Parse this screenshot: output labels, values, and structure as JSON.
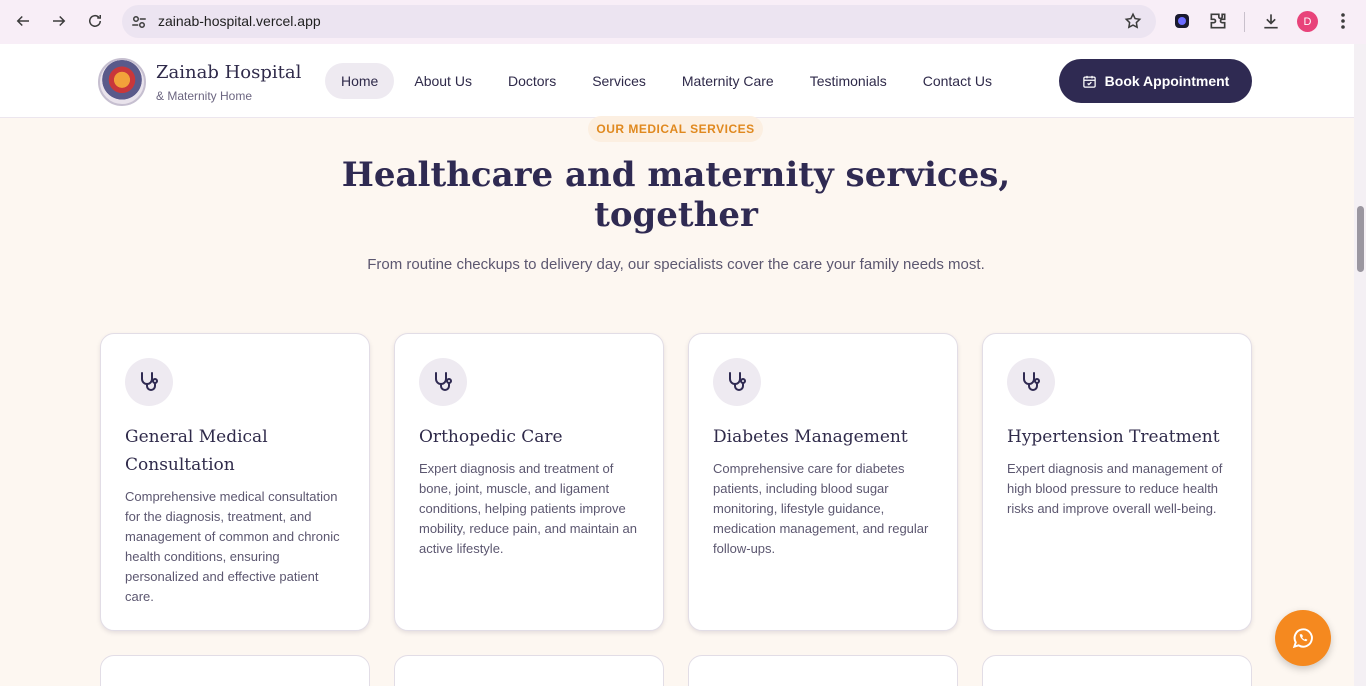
{
  "browser": {
    "url": "zainab-hospital.vercel.app",
    "profile_initial": "D"
  },
  "header": {
    "brand_name": "Zainab Hospital",
    "brand_sub": "& Maternity Home",
    "menu": [
      {
        "label": "Home",
        "active": true
      },
      {
        "label": "About Us"
      },
      {
        "label": "Doctors"
      },
      {
        "label": "Services"
      },
      {
        "label": "Maternity Care"
      },
      {
        "label": "Testimonials"
      },
      {
        "label": "Contact Us"
      }
    ],
    "book_label": "Book Appointment"
  },
  "section": {
    "eyebrow": "OUR MEDICAL SERVICES",
    "headline_line1": "Healthcare and maternity services,",
    "headline_line2": "together",
    "subline": "From routine checkups to delivery day, our specialists cover the care your family needs most."
  },
  "cards": [
    {
      "title": "General Medical Consultation",
      "desc": "Comprehensive medical consultation for the diagnosis, treatment, and management of common and chronic health conditions, ensuring personalized and effective patient care.",
      "icon": "stethoscope-icon"
    },
    {
      "title": "Orthopedic Care",
      "desc": "Expert diagnosis and treatment of bone, joint, muscle, and ligament conditions, helping patients improve mobility, reduce pain, and maintain an active lifestyle.",
      "icon": "stethoscope-icon"
    },
    {
      "title": "Diabetes Management",
      "desc": "Comprehensive care for diabetes patients, including blood sugar monitoring, lifestyle guidance, medication management, and regular follow-ups.",
      "icon": "stethoscope-icon"
    },
    {
      "title": "Hypertension Treatment",
      "desc": "Expert diagnosis and management of high blood pressure to reduce health risks and improve overall well-being.",
      "icon": "stethoscope-icon"
    }
  ],
  "colors": {
    "primary": "#2f2a52",
    "accent": "#f5891f",
    "background": "#fdf7f1"
  }
}
